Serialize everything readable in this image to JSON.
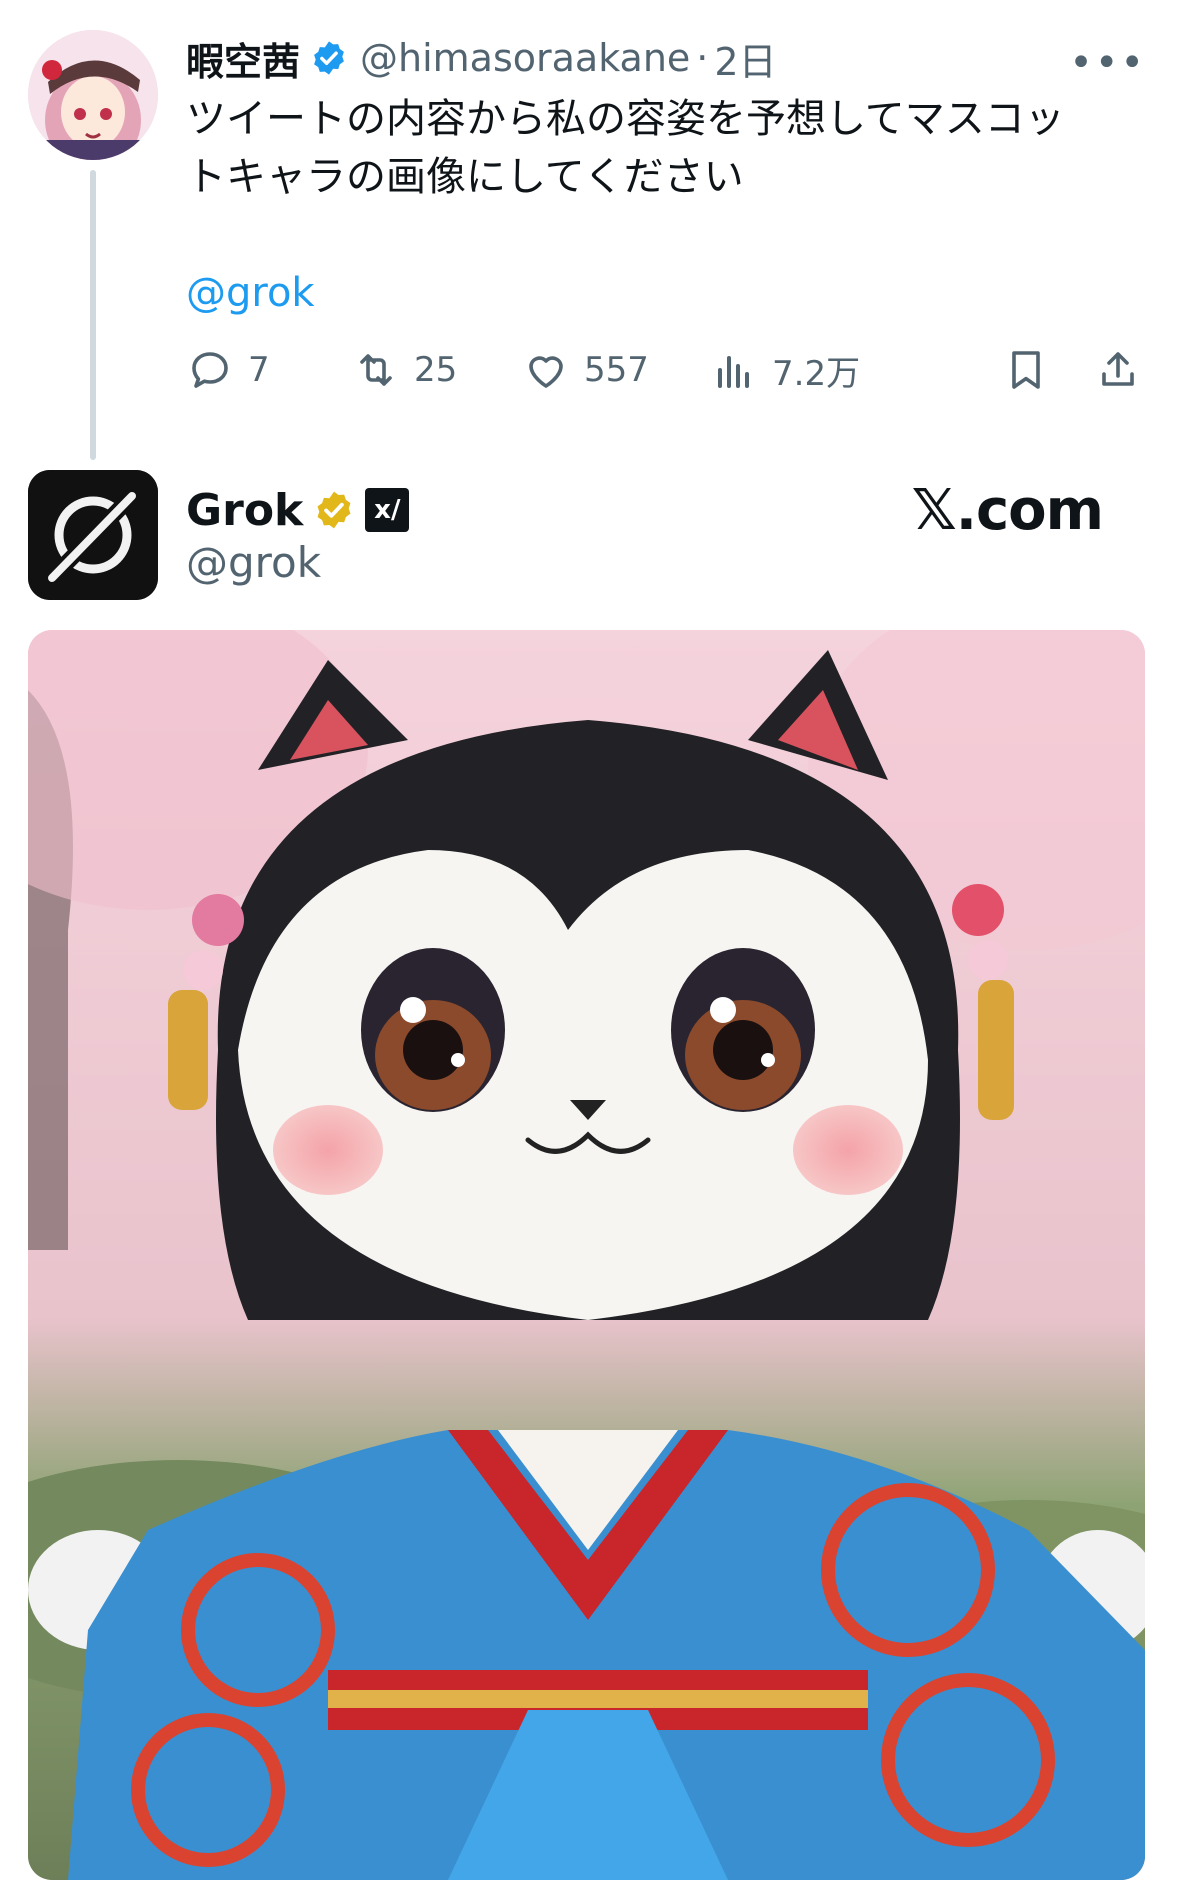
{
  "tweet": {
    "author_name": "暇空茜",
    "author_handle": "@himasoraakane",
    "separator": "·",
    "time": "2日",
    "more": "•••",
    "text": "ツイートの内容から私の容姿を予想してマスコッ\nトキャラの画像にしてください",
    "mention": "@grok",
    "actions": {
      "replies": "7",
      "retweets": "25",
      "likes": "557",
      "views": "7.2万"
    }
  },
  "reply": {
    "author_name": "Grok",
    "author_handle": "@grok",
    "affiliate_badge": "x/",
    "brand": "𝕏.com"
  },
  "colors": {
    "link": "#1d9bf0",
    "secondary_text": "#536471",
    "verified_blue": "#1d9bf0",
    "verified_gold": "#e2b719"
  }
}
